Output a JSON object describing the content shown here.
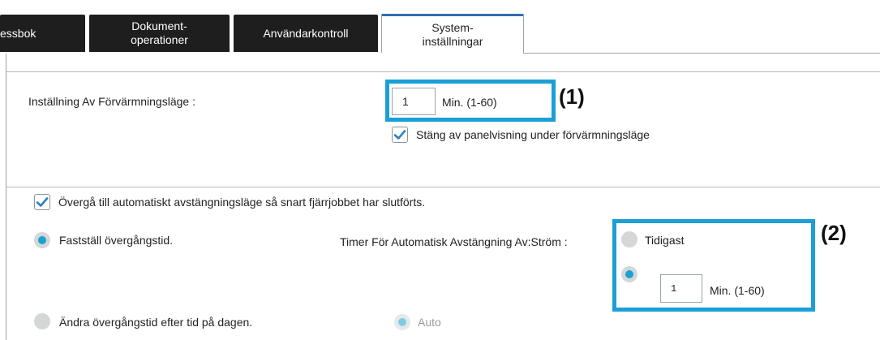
{
  "tabs": [
    {
      "label": "essbok"
    },
    {
      "label": "Dokument-\noperationer"
    },
    {
      "label": "Användarkontroll"
    },
    {
      "label": "System-\ninställningar"
    }
  ],
  "preheat": {
    "label": "Inställning Av Förvärmningsläge :",
    "value": "1",
    "unit": "Min. (1-60)",
    "panel_off_label": "Stäng av panelvisning under förvärmningsläge",
    "panel_off_checked": true
  },
  "auto_off": {
    "checkbox_label": "Övergå till automatiskt avstängningsläge så snart fjärrjobbet har slutförts.",
    "checkbox_checked": true,
    "fixed_time_label": "Fastställ övergångstid.",
    "timer_label": "Timer För Automatisk Avstängning Av:Ström :",
    "earliest_label": "Tidigast",
    "minutes_value": "1",
    "minutes_unit": "Min. (1-60)",
    "time_of_day_label": "Ändra övergångstid efter tid på dagen.",
    "auto_label": "Auto"
  },
  "callouts": {
    "first": "(1)",
    "second": "(2)"
  },
  "colors": {
    "tab_dark": "#1e1e1e",
    "accent": "#1a9fd6",
    "radio_on": "#1aa3cf",
    "check": "#2f7fc1"
  }
}
